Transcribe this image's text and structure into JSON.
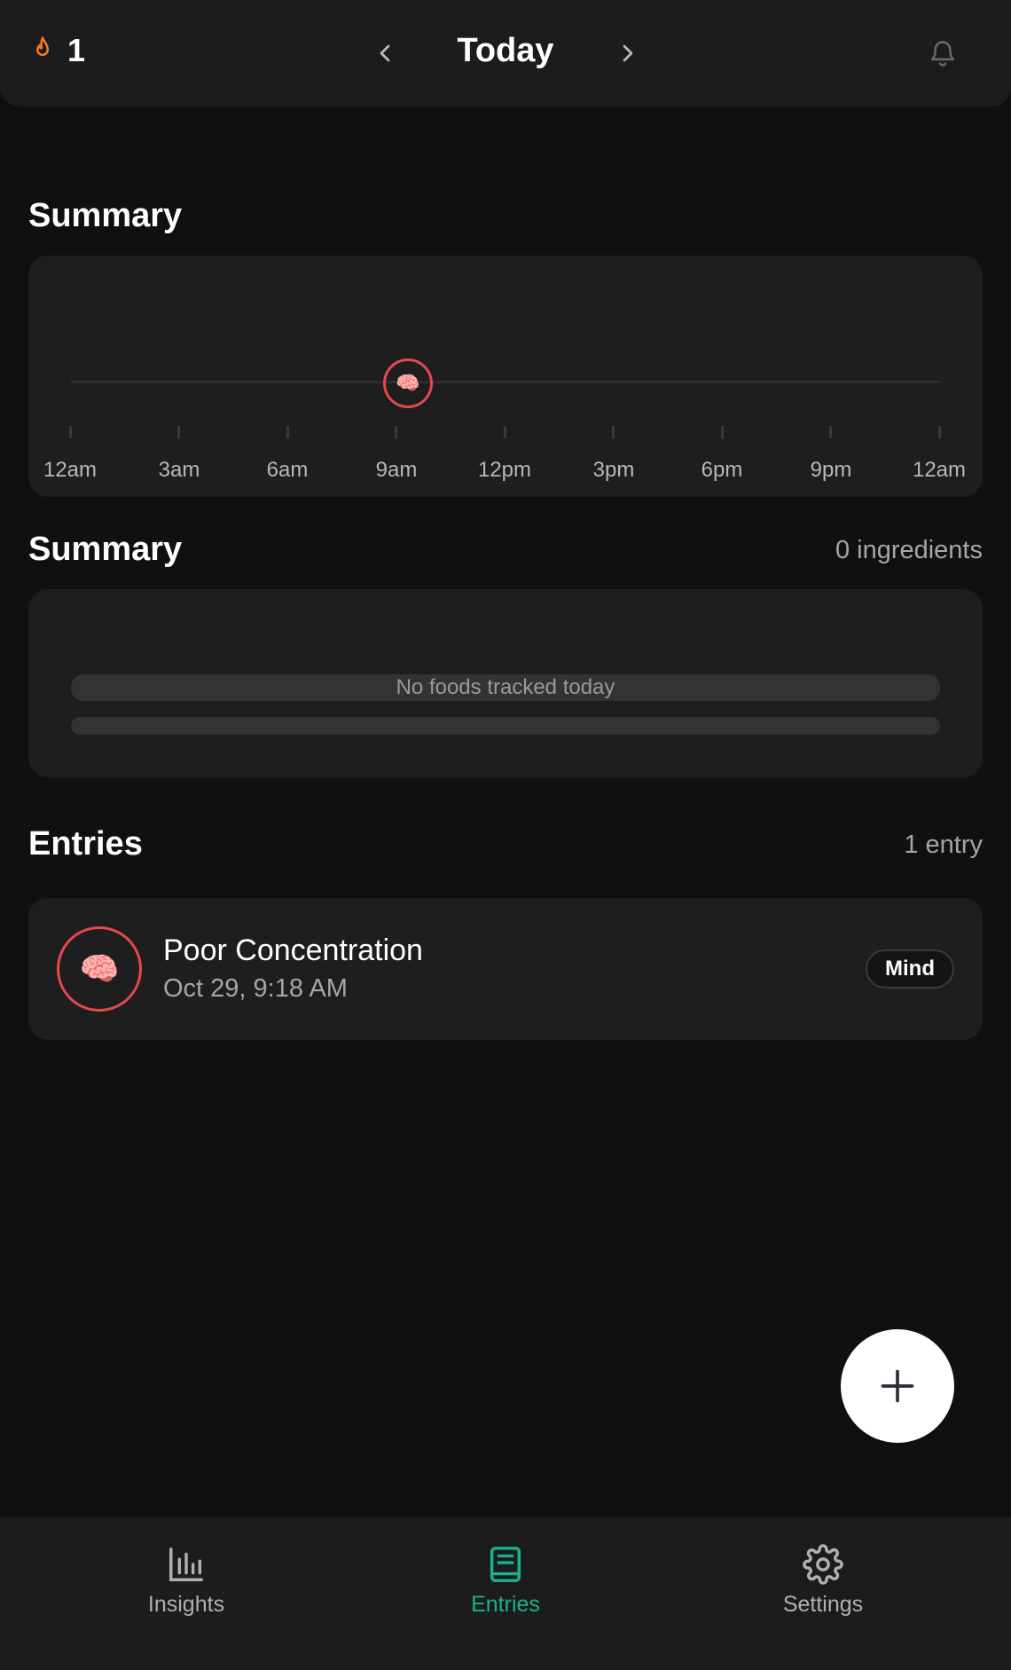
{
  "header": {
    "streak_count": "1",
    "title": "Today",
    "streak_icon": "flame-icon",
    "prev_icon": "chevron-left-icon",
    "next_icon": "chevron-right-icon",
    "bell_icon": "bell-icon"
  },
  "timeline_section": {
    "title": "Summary",
    "labels": [
      "12am",
      "3am",
      "6am",
      "9am",
      "12pm",
      "3pm",
      "6pm",
      "9pm",
      "12am"
    ],
    "marker_emoji": "🧠",
    "marker_color": "#e5484d"
  },
  "food_section": {
    "title": "Summary",
    "meta": "0 ingredients",
    "empty_text": "No foods tracked today"
  },
  "entries_section": {
    "title": "Entries",
    "meta": "1 entry",
    "items": [
      {
        "emoji": "🧠",
        "title": "Poor Concentration",
        "time": "Oct 29, 9:18 AM",
        "category": "Mind"
      }
    ]
  },
  "fab": {
    "icon": "plus-icon"
  },
  "bottom_nav": {
    "items": [
      {
        "label": "Insights",
        "icon": "bar-chart-icon",
        "active": false
      },
      {
        "label": "Entries",
        "icon": "book-icon",
        "active": true
      },
      {
        "label": "Settings",
        "icon": "gear-icon",
        "active": false
      }
    ]
  },
  "colors": {
    "background": "#101010",
    "card": "#1e1e1e",
    "accent": "#17b38c",
    "streak": "#f07a2a",
    "marker": "#e5484d"
  }
}
